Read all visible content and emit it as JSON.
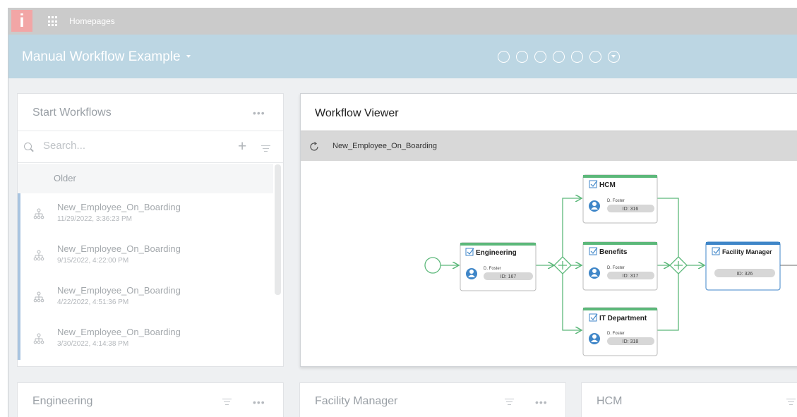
{
  "topbar": {
    "title": "Homepages",
    "logo": "i"
  },
  "header": {
    "title": "Manual Workflow Example",
    "step_count": 7,
    "active_step": 7
  },
  "start_workflows": {
    "title": "Start Workflows",
    "more": "•••",
    "search_placeholder": "Search...",
    "group_label": "Older",
    "items": [
      {
        "name": "New_Employee_On_Boarding",
        "date": "11/29/2022, 3:36:23 PM"
      },
      {
        "name": "New_Employee_On_Boarding",
        "date": "9/15/2022, 4:22:00 PM"
      },
      {
        "name": "New_Employee_On_Boarding",
        "date": "4/22/2022, 4:51:36 PM"
      },
      {
        "name": "New_Employee_On_Boarding",
        "date": "3/30/2022, 4:14:38 PM"
      }
    ]
  },
  "viewer": {
    "title": "Workflow Viewer",
    "workflow_name": "New_Employee_On_Boarding",
    "tasks": {
      "engineering": {
        "label": "Engineering",
        "user": "D. Foster",
        "id": "ID: 167"
      },
      "hcm": {
        "label": "HCM",
        "user": "D. Foster",
        "id": "ID: 316"
      },
      "benefits": {
        "label": "Benefits",
        "user": "D. Foster",
        "id": "ID: 317"
      },
      "it": {
        "label": "IT Department",
        "user": "D. Foster",
        "id": "ID: 318"
      },
      "facility": {
        "label": "Facility Manager",
        "id": "ID: 326"
      }
    }
  },
  "bottom_panels": {
    "engineering": {
      "title": "Engineering",
      "more": "•••"
    },
    "facility": {
      "title": "Facility Manager",
      "more": "•••"
    },
    "hcm": {
      "title": "HCM"
    }
  },
  "colors": {
    "header": "#bcd6e3",
    "done": "#5cb87a",
    "current": "#3f86c8",
    "logo": "#f2a6a6"
  }
}
